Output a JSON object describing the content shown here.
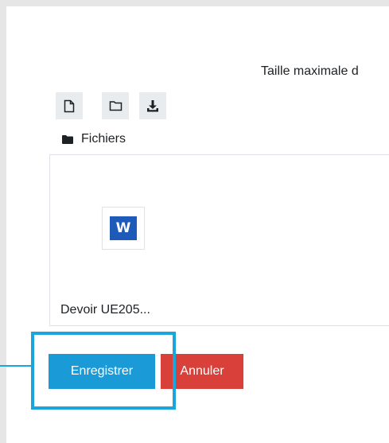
{
  "header": {
    "max_size_text": "Taille maximale d"
  },
  "toolbar": {
    "buttons": [
      {
        "icon": "file-icon"
      },
      {
        "icon": "folder-icon"
      },
      {
        "icon": "download-icon"
      }
    ]
  },
  "path": {
    "icon": "folder-icon",
    "label": "Fichiers"
  },
  "files": [
    {
      "icon": "word-document-icon",
      "icon_letter": "W",
      "name": "Devoir UE205..."
    }
  ],
  "actions": {
    "save_label": "Enregistrer",
    "cancel_label": "Annuler"
  },
  "colors": {
    "save": "#1a9bd7",
    "cancel": "#d9403a",
    "highlight": "#1aa6dc",
    "word": "#1e5ab8"
  }
}
